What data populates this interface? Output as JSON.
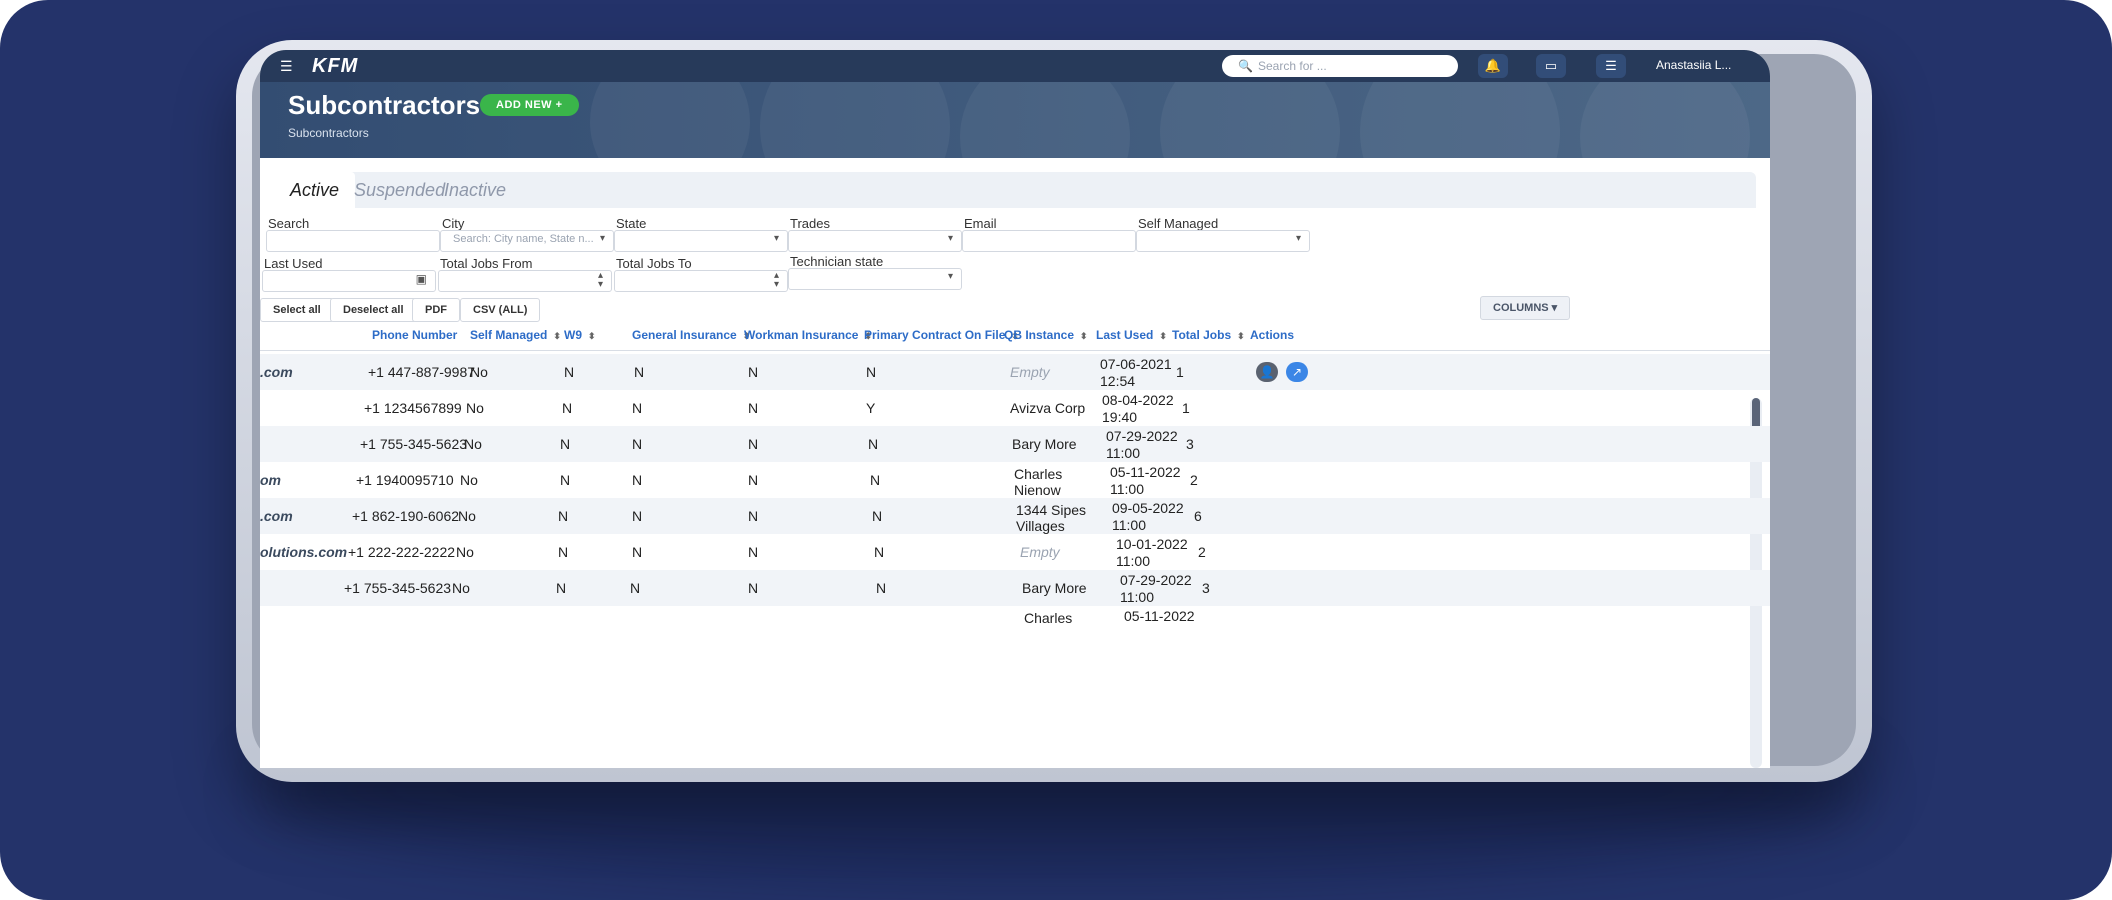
{
  "app": {
    "logo_text": "KFM",
    "user": "Anastasiia L...",
    "search_placeholder": "Search for ..."
  },
  "page": {
    "title": "Subcontractors",
    "subtitle": "Subcontractors",
    "add_new_label": "ADD NEW +"
  },
  "tabs": [
    "Active",
    "Suspended",
    "Inactive"
  ],
  "filters": {
    "search": "Search",
    "city": "City",
    "city_placeholder": "Search: City name, State n...",
    "state": "State",
    "trades": "Trades",
    "email": "Email",
    "self_managed": "Self Managed",
    "last_used": "Last Used",
    "total_jobs_from": "Total Jobs From",
    "total_jobs_to": "Total Jobs To",
    "technician_state": "Technician state"
  },
  "buttons": {
    "select_all": "Select all",
    "deselect_all": "Deselect all",
    "pdf": "PDF",
    "csv": "CSV (ALL)",
    "columns": "COLUMNS ▾"
  },
  "table": {
    "headers": [
      "Phone Number",
      "Self Managed",
      "W9",
      "General Insurance",
      "Workman Insurance",
      "Primary Contract On File",
      "QB Instance",
      "Last Used",
      "Total Jobs",
      "Actions"
    ],
    "rows": [
      {
        "email": ".com",
        "phone": "+1 447-887-9987",
        "self_managed": "No",
        "w9": "N",
        "general": "N",
        "workman": "N",
        "primary": "N",
        "qb1": "Empty",
        "qb2": "",
        "last1": "07-06-2021",
        "last2": "12:54",
        "total": "1"
      },
      {
        "email": "",
        "phone": "+1 1234567899",
        "self_managed": "No",
        "w9": "N",
        "general": "N",
        "workman": "N",
        "primary": "Y",
        "qb1": "Avizva Corp",
        "qb2": "",
        "last1": "08-04-2022",
        "last2": "19:40",
        "total": "1"
      },
      {
        "email": "",
        "phone": "+1 755-345-5623",
        "self_managed": "No",
        "w9": "N",
        "general": "N",
        "workman": "N",
        "primary": "N",
        "qb1": "Bary More",
        "qb2": "",
        "last1": "07-29-2022",
        "last2": "11:00",
        "total": "3"
      },
      {
        "email": "om",
        "phone": "+1 1940095710",
        "self_managed": "No",
        "w9": "N",
        "general": "N",
        "workman": "N",
        "primary": "N",
        "qb1": "Charles",
        "qb2": "Nienow",
        "last1": "05-11-2022",
        "last2": "11:00",
        "total": "2"
      },
      {
        "email": ".com",
        "phone": "+1 862-190-6062",
        "self_managed": "No",
        "w9": "N",
        "general": "N",
        "workman": "N",
        "primary": "N",
        "qb1": "1344 Sipes",
        "qb2": "Villages",
        "last1": "09-05-2022",
        "last2": "11:00",
        "total": "6"
      },
      {
        "email": "olutions.com",
        "phone": "+1 222-222-2222",
        "self_managed": "No",
        "w9": "N",
        "general": "N",
        "workman": "N",
        "primary": "N",
        "qb1": "Empty",
        "qb2": "",
        "last1": "10-01-2022",
        "last2": "11:00",
        "total": "2"
      },
      {
        "email": "",
        "phone": "+1 755-345-5623",
        "self_managed": "No",
        "w9": "N",
        "general": "N",
        "workman": "N",
        "primary": "N",
        "qb1": "Bary More",
        "qb2": "",
        "last1": "07-29-2022",
        "last2": "11:00",
        "total": "3"
      },
      {
        "email": "",
        "phone": "",
        "self_managed": "",
        "w9": "",
        "general": "",
        "workman": "",
        "primary": "",
        "qb1": "Charles",
        "qb2": "",
        "last1": "05-11-2022",
        "last2": "",
        "total": ""
      }
    ]
  },
  "colors": {
    "background": "#24336a",
    "accent_blue": "#2d6cc7",
    "green": "#3ab54a",
    "topbar": "#273a5a"
  },
  "icons": [
    "hamburger-icon",
    "search-icon",
    "bell-icon",
    "chat-icon",
    "list-icon",
    "calendar-icon",
    "chevron-down-icon",
    "sort-icon"
  ]
}
